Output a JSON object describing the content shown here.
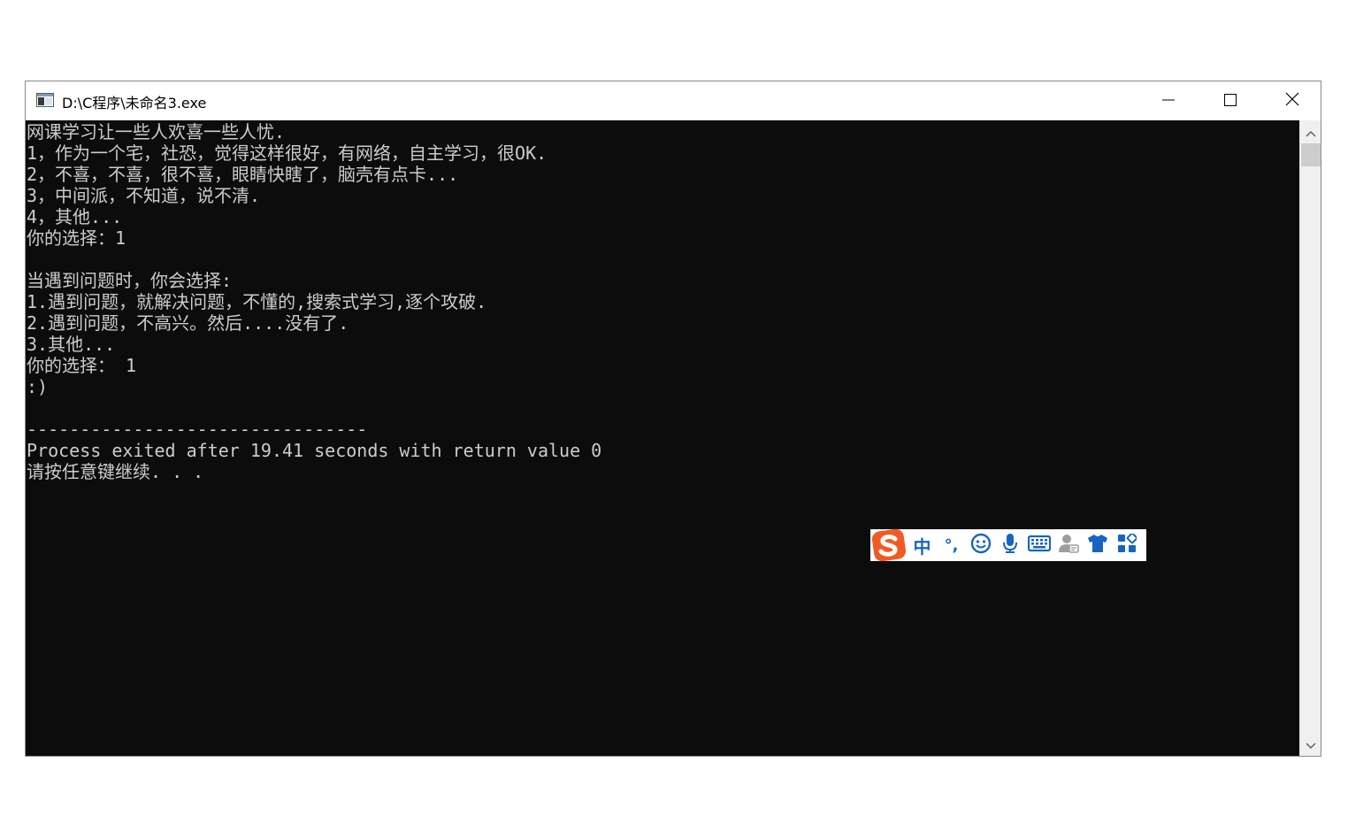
{
  "window": {
    "title": "D:\\C程序\\未命名3.exe"
  },
  "console": {
    "lines": [
      "网课学习让一些人欢喜一些人忧.",
      "1，作为一个宅，社恐，觉得这样很好，有网络，自主学习，很OK.",
      "2，不喜，不喜，很不喜，眼睛快瞎了，脑壳有点卡...",
      "3，中间派，不知道，说不清.",
      "4，其他...",
      "你的选择：1",
      "",
      "当遇到问题时，你会选择:",
      "1.遇到问题，就解决问题，不懂的,搜索式学习,逐个攻破.",
      "2.遇到问题，不高兴。然后....没有了.",
      "3.其他...",
      "你的选择： 1",
      ":)",
      "",
      "--------------------------------",
      "Process exited after 19.41 seconds with return value 0",
      "请按任意键继续. . ."
    ]
  },
  "ime": {
    "lang_label": "中",
    "punct_label": "°,",
    "icons": [
      "sogou-logo",
      "emoji-icon",
      "microphone-icon",
      "keyboard-icon",
      "user-icon",
      "skin-shirt-icon",
      "toolbox-grid-icon"
    ],
    "accent_color": "#1565c0",
    "logo_color": "#f15a24"
  }
}
